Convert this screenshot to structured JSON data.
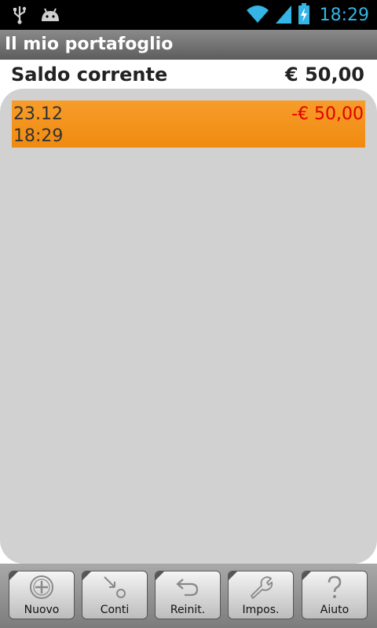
{
  "status_bar": {
    "time": "18:29",
    "icons": [
      "usb-icon",
      "android-debug-icon",
      "wifi-icon",
      "signal-icon",
      "battery-charging-icon"
    ],
    "accent_color": "#34b5e5"
  },
  "app": {
    "title": "Il mio portafoglio"
  },
  "balance": {
    "label": "Saldo corrente",
    "amount": "€ 50,00"
  },
  "transactions": [
    {
      "date": "23.12",
      "time": "18:29",
      "amount": "-€ 50,00",
      "amount_color": "#e00000",
      "row_color": "#f39520"
    }
  ],
  "toolbar": {
    "buttons": [
      {
        "label": "Nuovo",
        "icon": "add-icon"
      },
      {
        "label": "Conti",
        "icon": "accounts-icon"
      },
      {
        "label": "Reinit.",
        "icon": "undo-icon"
      },
      {
        "label": "Impos.",
        "icon": "wrench-icon"
      },
      {
        "label": "Aiuto",
        "icon": "help-icon"
      }
    ]
  }
}
